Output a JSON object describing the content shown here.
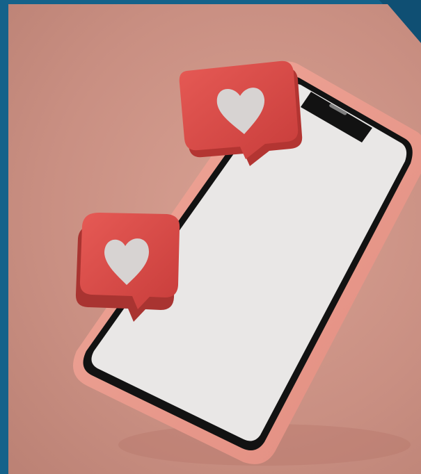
{
  "colors": {
    "frame": "#14628a",
    "background": "#c98f82",
    "phone_case": "#e7998c",
    "screen": "#e9e7e6",
    "heart_bubble": "#d94a47",
    "heart": "#d7d3d2"
  },
  "icons": [
    "phone-mockup",
    "heart-icon",
    "heart-icon"
  ]
}
